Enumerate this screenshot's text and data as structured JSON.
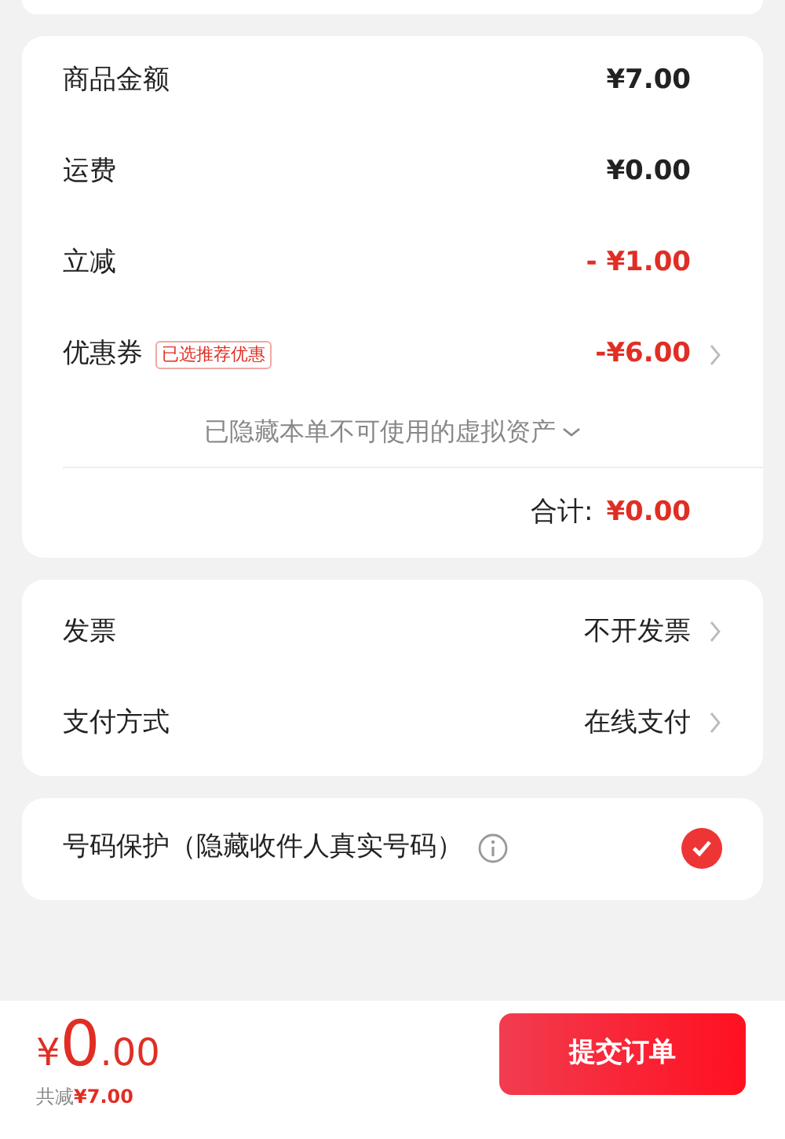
{
  "summary": {
    "rows": [
      {
        "kind": "amount",
        "label": "商品金额",
        "value": "¥7.00",
        "link": false
      },
      {
        "kind": "amount",
        "label": "运费",
        "value": "¥0.00",
        "link": false
      },
      {
        "kind": "discount",
        "label": "立减",
        "value": "- ¥1.00",
        "link": false
      },
      {
        "kind": "discount",
        "label": "优惠券",
        "badge": "已选推荐优惠",
        "value": "-¥6.00",
        "link": true
      }
    ],
    "hidden_note": "已隐藏本单不可使用的虚拟资产",
    "total_label": "合计:",
    "total_value": "¥0.00"
  },
  "options": [
    {
      "label": "发票",
      "value": "不开发票"
    },
    {
      "label": "支付方式",
      "value": "在线支付"
    }
  ],
  "privacy": {
    "label": "号码保护（隐藏收件人真实号码）",
    "checked": true
  },
  "footer": {
    "currency": "¥",
    "integer": "0",
    "decimals": ".00",
    "saved_label": "共减",
    "saved_value": "¥7.00",
    "submit": "提交订单"
  }
}
